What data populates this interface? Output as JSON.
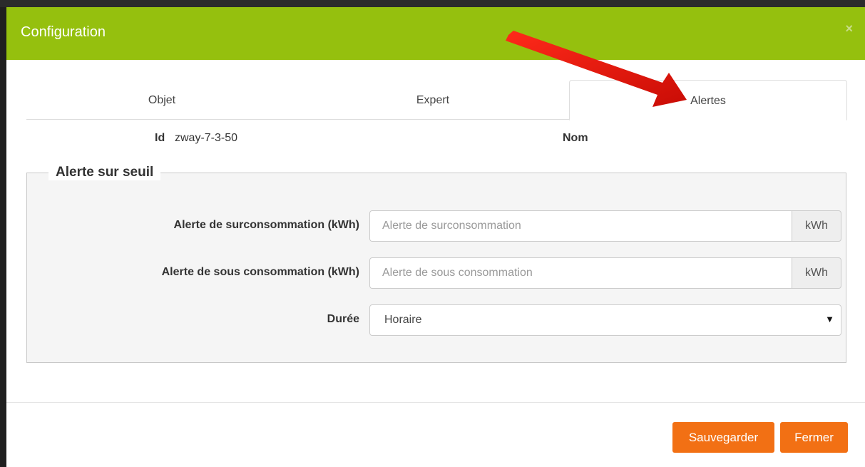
{
  "modal": {
    "title": "Configuration",
    "close_symbol": "×"
  },
  "tabs": [
    {
      "label": "Objet",
      "active": false
    },
    {
      "label": "Expert",
      "active": false
    },
    {
      "label": "Alertes",
      "active": true
    }
  ],
  "info": {
    "id_label": "Id",
    "id_value": "zway-7-3-50",
    "name_label": "Nom"
  },
  "fieldset": {
    "legend": "Alerte sur seuil",
    "overconsumption": {
      "label": "Alerte de surconsommation (kWh)",
      "placeholder": "Alerte de surconsommation",
      "unit": "kWh"
    },
    "underconsumption": {
      "label": "Alerte de sous consommation (kWh)",
      "placeholder": "Alerte de sous consommation",
      "unit": "kWh"
    },
    "duration": {
      "label": "Durée",
      "value": "Horaire",
      "arrow": "▼"
    }
  },
  "buttons": {
    "save": "Sauvegarder",
    "close": "Fermer"
  },
  "colors": {
    "header": "#95c00e",
    "button": "#f27014",
    "annotation_arrow": "#e8150e"
  },
  "icons": [
    "close-icon",
    "chevron-down-icon",
    "annotation-arrow-icon"
  ]
}
